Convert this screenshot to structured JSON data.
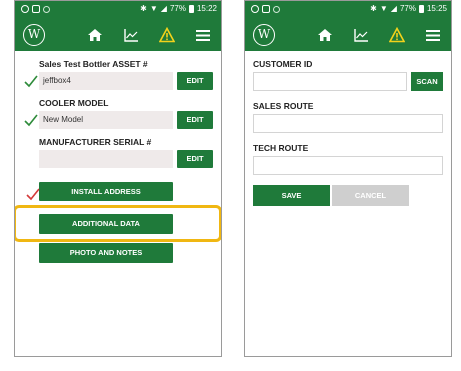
{
  "left_screen": {
    "status": {
      "battery": "77%",
      "time": "15:22"
    },
    "fields": [
      {
        "label": "Sales Test Bottler ASSET #",
        "value": "jeffbox4",
        "button": "EDIT",
        "checked": true
      },
      {
        "label": "COOLER MODEL",
        "value": "New Model",
        "button": "EDIT",
        "checked": true
      },
      {
        "label": "MANUFACTURER SERIAL #",
        "value": "",
        "button": "EDIT",
        "checked": false
      }
    ],
    "buttons": {
      "install_address": "INSTALL ADDRESS",
      "additional_data": "ADDITIONAL DATA",
      "photo_and_notes": "PHOTO AND NOTES"
    }
  },
  "right_screen": {
    "status": {
      "battery": "77%",
      "time": "15:25"
    },
    "customer_id_label": "CUSTOMER ID",
    "scan_label": "SCAN",
    "sales_route_label": "SALES ROUTE",
    "tech_route_label": "TECH ROUTE",
    "save_label": "SAVE",
    "cancel_label": "CANCEL"
  },
  "colors": {
    "brand_green": "#1f7a3a",
    "highlight": "#f0b712",
    "check_green": "#2e8b3a",
    "check_red": "#d33a3a",
    "warning_yellow": "#f2d21b"
  },
  "icons": {
    "home": "home-icon",
    "chart": "chart-icon",
    "warning": "warning-icon",
    "menu": "menu-icon",
    "logo": "brand-logo-icon"
  }
}
